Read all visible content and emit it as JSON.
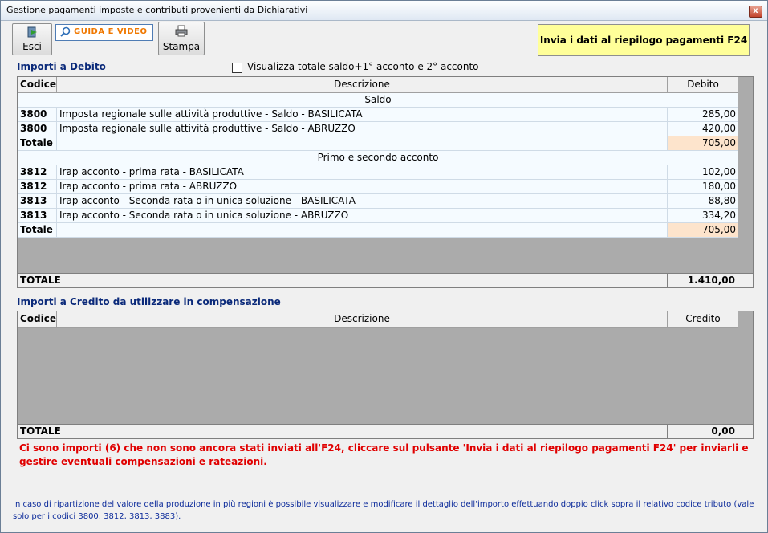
{
  "window": {
    "title": "Gestione pagamenti imposte e contributi provenienti da Dichiarativi",
    "close_glyph": "x"
  },
  "toolbar": {
    "esci_label": "Esci",
    "guida_label": "GUIDA E VIDEO",
    "stampa_label": "Stampa",
    "invia_label": "Invia i dati al riepilogo pagamenti F24"
  },
  "debito": {
    "title": "Importi a Debito",
    "checkbox_label": "Visualizza totale saldo+1° acconto e 2° acconto",
    "headers": {
      "code": "Codice",
      "desc": "Descrizione",
      "val": "Debito"
    },
    "group_saldo": "Saldo",
    "saldo_rows": [
      {
        "code": "3800",
        "desc": "Imposta regionale sulle attività produttive - Saldo - BASILICATA",
        "val": "285,00"
      },
      {
        "code": "3800",
        "desc": "Imposta regionale sulle attività produttive - Saldo - ABRUZZO",
        "val": "420,00"
      }
    ],
    "saldo_total_label": "Totale",
    "saldo_total": "705,00",
    "group_acconto": "Primo e secondo acconto",
    "acconto_rows": [
      {
        "code": "3812",
        "desc": "Irap acconto - prima rata - BASILICATA",
        "val": "102,00"
      },
      {
        "code": "3812",
        "desc": "Irap acconto - prima rata - ABRUZZO",
        "val": "180,00"
      },
      {
        "code": "3813",
        "desc": "Irap acconto - Seconda rata o in unica soluzione - BASILICATA",
        "val": "88,80"
      },
      {
        "code": "3813",
        "desc": "Irap acconto - Seconda rata o in unica soluzione - ABRUZZO",
        "val": "334,20"
      }
    ],
    "acconto_total_label": "Totale",
    "acconto_total": "705,00",
    "grand_total_label": "TOTALE",
    "grand_total": "1.410,00"
  },
  "credito": {
    "title": "Importi a Credito da utilizzare in compensazione",
    "headers": {
      "code": "Codice",
      "desc": "Descrizione",
      "val": "Credito"
    },
    "grand_total_label": "TOTALE",
    "grand_total": "0,00"
  },
  "warning": "Ci sono importi (6) che non sono ancora stati inviati all'F24, cliccare sul pulsante 'Invia i dati al riepilogo pagamenti F24' per inviarli e gestire eventuali compensazioni e rateazioni.",
  "note": "In caso di ripartizione del valore della produzione in più regioni è possibile visualizzare e modificare il dettaglio dell'importo effettuando doppio click sopra il relativo codice tributo (vale solo per i codici 3800, 3812, 3813, 3883)."
}
